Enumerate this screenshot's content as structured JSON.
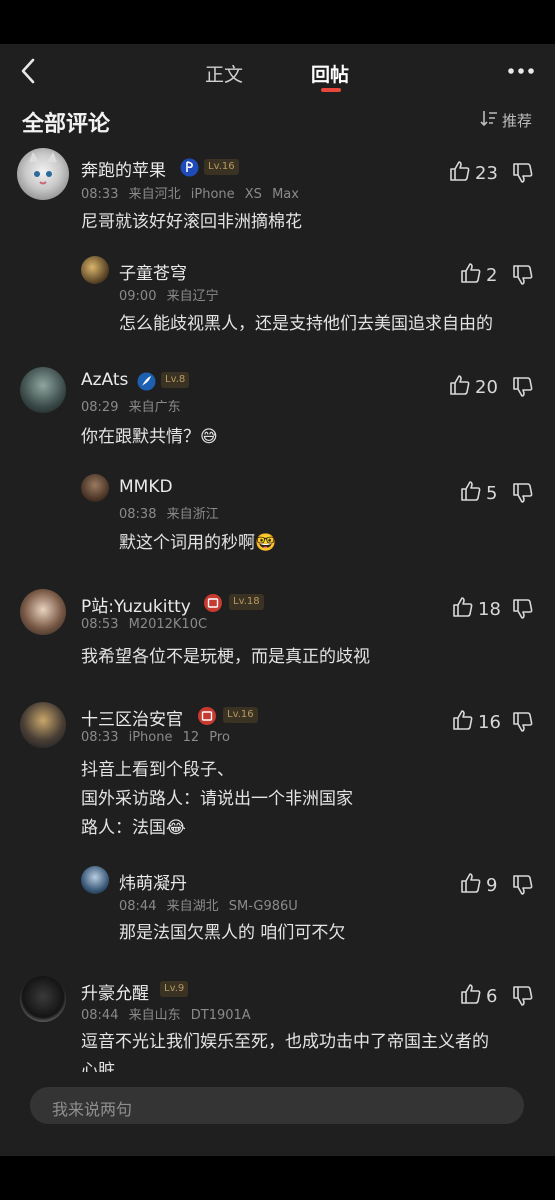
{
  "nav": {
    "tab_content": "正文",
    "tab_replies": "回帖"
  },
  "section": {
    "title": "全部评论",
    "sort_label": "推荐"
  },
  "comments": [
    {
      "name": "奔跑的苹果",
      "level": "Lv.16",
      "time": "08:33",
      "location": "来自河北",
      "device": "iPhone XS Max",
      "likes": "23",
      "text": "尼哥就该好好滚回非洲摘棉花"
    },
    {
      "name": "子童苍穹",
      "time": "09:00",
      "location": "来自辽宁",
      "likes": "2",
      "text": "怎么能歧视黑人，还是支持他们去美国追求自由的"
    },
    {
      "name": "AzAts",
      "level": "Lv.8",
      "time": "08:29",
      "location": "来自广东",
      "likes": "20",
      "text": "你在跟默共情？😅"
    },
    {
      "name": "MMKD",
      "time": "08:38",
      "location": "来自浙江",
      "likes": "5",
      "text": "默这个词用的秒啊🤓"
    },
    {
      "name": "P站:Yuzukitty",
      "level": "Lv.18",
      "time": "08:53",
      "device": "M2012K10C",
      "likes": "18",
      "text": "我希望各位不是玩梗，而是真正的歧视"
    },
    {
      "name": "十三区治安官",
      "level": "Lv.16",
      "time": "08:33",
      "device": "iPhone 12 Pro",
      "likes": "16",
      "lines": [
        "抖音上看到个段子、",
        "国外采访路人：请说出一个非洲国家",
        "路人：法国😂"
      ]
    },
    {
      "name": "炜萌凝丹",
      "time": "08:44",
      "location": "来自湖北",
      "device": "SM-G986U",
      "likes": "9",
      "text": "那是法国欠黑人的 咱们可不欠"
    },
    {
      "name": "升豪允醒",
      "level": "Lv.9",
      "time": "08:44",
      "location": "来自山东",
      "device": "DT1901A",
      "likes": "6",
      "lines": [
        "逗音不光让我们娱乐至死，也成功击中了帝国主义者的",
        "心脏"
      ]
    }
  ],
  "composer": {
    "placeholder": "我来说两句"
  }
}
